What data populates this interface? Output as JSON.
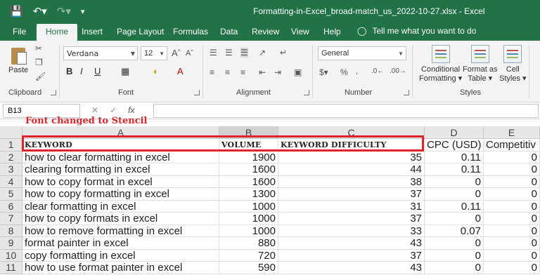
{
  "window": {
    "title": "Formatting-in-Excel_broad-match_us_2022-10-27.xlsx  -  Excel"
  },
  "tabs": [
    "File",
    "Home",
    "Insert",
    "Page Layout",
    "Formulas",
    "Data",
    "Review",
    "View",
    "Help"
  ],
  "active_tab": "Home",
  "tell_me": "Tell me what you want to do",
  "ribbon": {
    "paste_label": "Paste",
    "clipboard_label": "Clipboard",
    "font_name": "Verdana",
    "font_size": "12",
    "font_label": "Font",
    "alignment_label": "Alignment",
    "number_format": "General",
    "number_label": "Number",
    "conditional_formatting": [
      "Conditional",
      "Formatting ▾"
    ],
    "format_as_table": [
      "Format as",
      "Table ▾"
    ],
    "cell_styles": [
      "Cell",
      "Styles ▾"
    ],
    "styles_label": "Styles",
    "bold": "B",
    "italic": "I",
    "underline": "U"
  },
  "formula_bar": {
    "name_box": "B13",
    "fx": "fx",
    "content": ""
  },
  "annotation": "Font changed to Stencil",
  "columns": [
    "A",
    "B",
    "C",
    "D",
    "E"
  ],
  "selected_column": "B",
  "selected_row": "13",
  "header_row": [
    "KEYWORD",
    "VOLUME",
    "KEYWORD DIFFICULTY",
    "CPC (USD)",
    "Competitiv"
  ],
  "rows": [
    {
      "n": "2",
      "keyword": "how to clear formatting in excel",
      "volume": "1900",
      "difficulty": "35",
      "cpc": "0.11",
      "comp": "0"
    },
    {
      "n": "3",
      "keyword": "clearing formatting in excel",
      "volume": "1600",
      "difficulty": "44",
      "cpc": "0.11",
      "comp": "0"
    },
    {
      "n": "4",
      "keyword": "how to copy format in excel",
      "volume": "1600",
      "difficulty": "38",
      "cpc": "0",
      "comp": "0"
    },
    {
      "n": "5",
      "keyword": "how to copy formatting in excel",
      "volume": "1300",
      "difficulty": "37",
      "cpc": "0",
      "comp": "0"
    },
    {
      "n": "6",
      "keyword": "clear formatting in excel",
      "volume": "1000",
      "difficulty": "31",
      "cpc": "0.11",
      "comp": "0"
    },
    {
      "n": "7",
      "keyword": "how to copy formats in excel",
      "volume": "1000",
      "difficulty": "37",
      "cpc": "0",
      "comp": "0"
    },
    {
      "n": "8",
      "keyword": "how to remove formatting in excel",
      "volume": "1000",
      "difficulty": "33",
      "cpc": "0.07",
      "comp": "0"
    },
    {
      "n": "9",
      "keyword": "format painter in excel",
      "volume": "880",
      "difficulty": "43",
      "cpc": "0",
      "comp": "0"
    },
    {
      "n": "10",
      "keyword": "copy formatting in excel",
      "volume": "720",
      "difficulty": "37",
      "cpc": "0",
      "comp": "0"
    },
    {
      "n": "11",
      "keyword": "how to use format painter in excel",
      "volume": "590",
      "difficulty": "43",
      "cpc": "0",
      "comp": "0"
    }
  ]
}
